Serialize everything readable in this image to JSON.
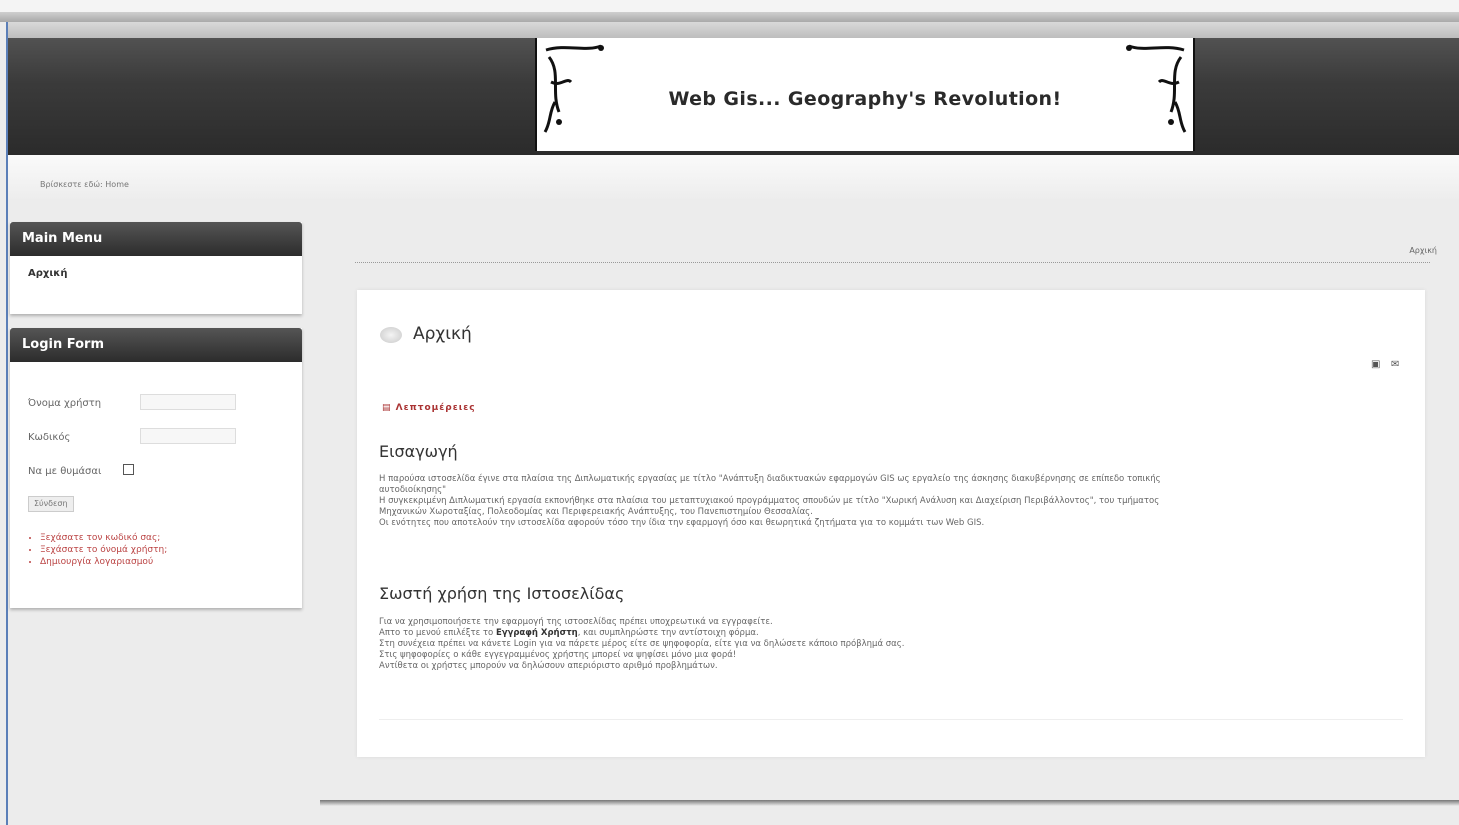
{
  "header": {
    "banner_title": "Web Gis... Geography's Revolution!"
  },
  "breadcrumb": "Βρίσκεστε εδώ: Home",
  "sidebar": {
    "main_menu": {
      "title": "Main Menu",
      "items": [
        {
          "label": "Αρχική"
        }
      ]
    },
    "login_form": {
      "title": "Login Form",
      "username_label": "Όνομα χρήστη",
      "username_value": "",
      "password_label": "Κωδικός",
      "password_value": "",
      "remember_label": "Να με θυμάσαι",
      "remember_checked": false,
      "login_button": "Σύνδεση",
      "links": [
        "Ξεχάσατε τον κωδικό σας;",
        "Ξεχάσατε το όνομά χρήστη;",
        "Δημιουργία λογαριασμού"
      ]
    }
  },
  "main": {
    "home_link": "Αρχική",
    "article": {
      "title": "Αρχική",
      "details_label": "Λεπτομέρειες",
      "tool_icons": [
        "print-icon",
        "email-icon"
      ],
      "section1_heading": "Εισαγωγή",
      "section1_lines": [
        "Η παρούσα ιστοσελίδα έγινε στα πλαίσια της Διπλωματικής εργασίας με τίτλο \"Ανάπτυξη διαδικτυακών εφαρμογών GIS ως εργαλείο της άσκησης διακυβέρνησης σε επίπεδο τοπικής",
        "αυτοδιοίκησης\"",
        "Η συγκεκριμένη Διπλωματική εργασία εκπονήθηκε στα πλαίσια του μεταπτυχιακού προγράμματος σπουδών με τίτλο \"Χωρική Ανάλυση και Διαχείριση Περιβάλλοντος\", του τμήματος",
        "Μηχανικών Χωροταξίας, Πολεοδομίας και Περιφερειακής Ανάπτυξης, του Πανεπιστημίου Θεσσαλίας.",
        "Οι ενότητες που αποτελούν την ιστοσελίδα αφορούν τόσο την ίδια την εφαρμογή όσο και θεωρητικά ζητήματα για το κομμάτι των Web GIS."
      ],
      "section2_heading": "Σωστή χρήση της Ιστοσελίδας",
      "section2_line1": "Για να χρησιμοποιήσετε την εφαρμογή της ιστοσελίδας πρέπει υποχρεωτικά να εγγραφείτε.",
      "section2_line2_pre": "Απτο το μενού επιλέξτε το ",
      "section2_line2_bold": "Εγγραφή Χρήστη",
      "section2_line2_post": ", και συμπληρώστε την αντίστοιχη φόρμα.",
      "section2_more_lines": [
        "Στη συνέχεια πρέπει να κάνετε Login για να πάρετε μέρος είτε σε ψηφοφορία, είτε για να δηλώσετε κάποιο πρόβλημά σας.",
        "Στις ψηφοφορίες ο κάθε εγγεγραμμένος χρήστης μπορεί να ψηφίσει μόνο μια φορά!",
        "Αντίθετα οι χρήστες μπορούν να δηλώσουν απεριόριστο αριθμό προβλημάτων."
      ]
    }
  }
}
